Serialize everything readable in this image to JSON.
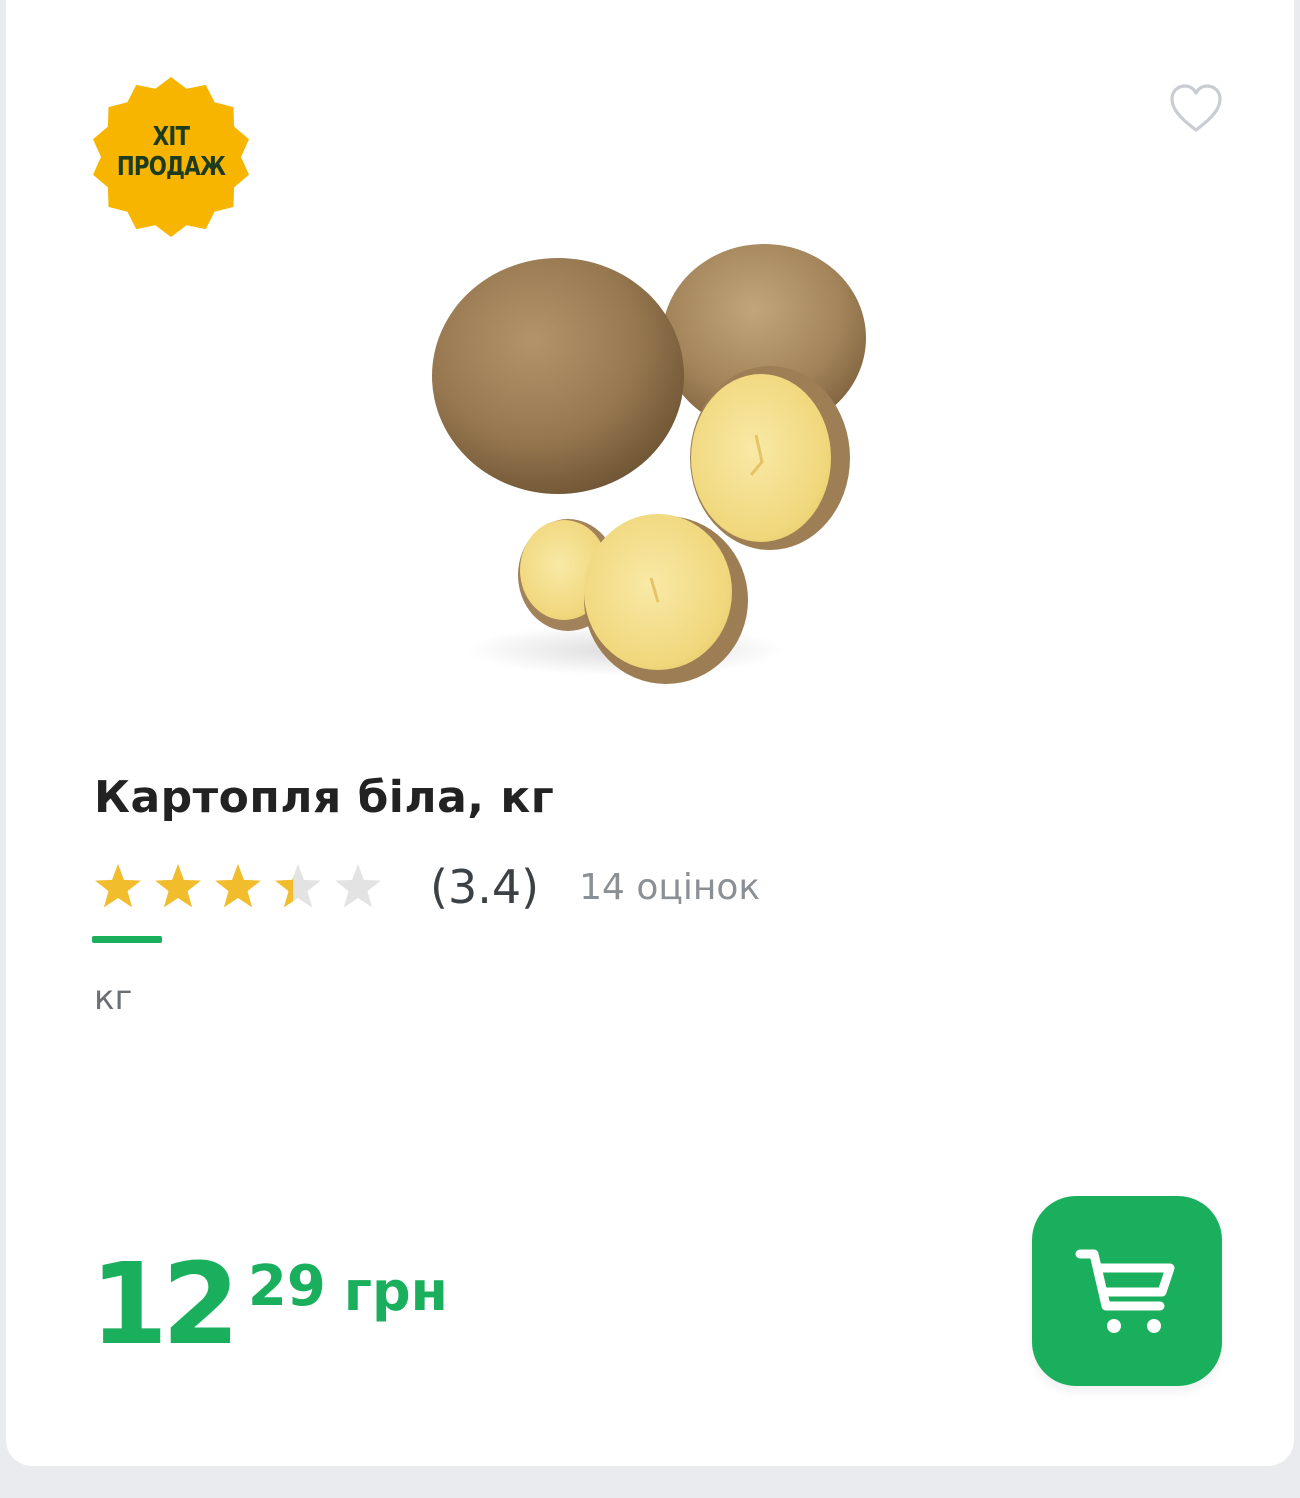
{
  "badge": {
    "line1": "ХІТ",
    "line2": "ПРОДАЖ",
    "color": "#f7b500"
  },
  "favorite": {
    "icon": "heart-outline-icon"
  },
  "product": {
    "image_alt": "Картопля біла",
    "title": "Картопля біла, кг",
    "rating": {
      "value": 3.4,
      "value_text": "(3.4)",
      "max": 5,
      "count_text": "14 оцінок"
    },
    "unit": "кг",
    "price": {
      "integer": "12",
      "fraction": "29",
      "currency": "грн"
    }
  },
  "cart": {
    "icon": "cart-icon"
  },
  "colors": {
    "accent": "#1aaf5d",
    "star_filled": "#f2bd2c",
    "star_empty": "#e3e3e3",
    "title": "#222222"
  }
}
